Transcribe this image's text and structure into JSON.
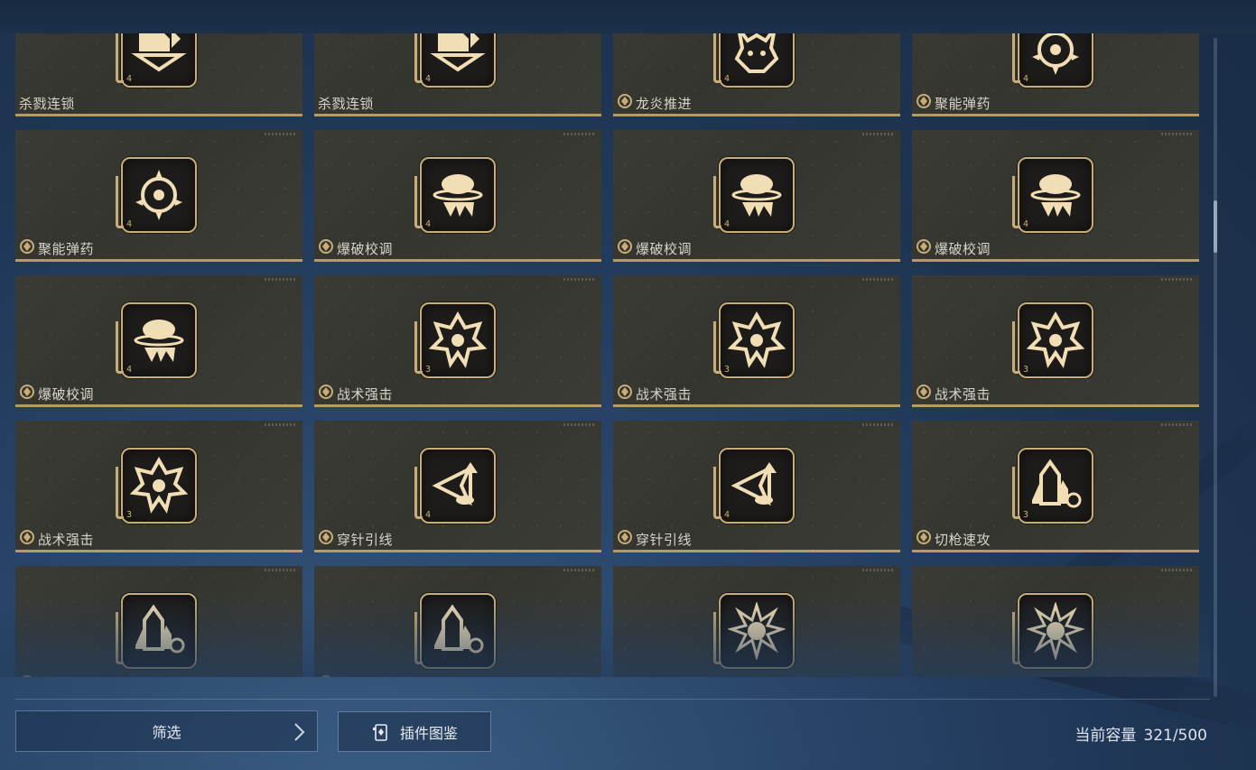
{
  "colors": {
    "card_bg": "#36362f",
    "gold_accent": "#b89b63",
    "icon_gold": "#f1deb5",
    "frame_gold": "#c9ad78",
    "background": "#22395a"
  },
  "modules": [
    {
      "label": "杀戮连锁",
      "icon": "kill-chain-icon",
      "tier": "4",
      "show_ring": false
    },
    {
      "label": "杀戮连锁",
      "icon": "kill-chain-icon",
      "tier": "4",
      "show_ring": false
    },
    {
      "label": "龙炎推进",
      "icon": "dragon-flame-icon",
      "tier": "4",
      "show_ring": true
    },
    {
      "label": "聚能弹药",
      "icon": "focus-ammo-icon",
      "tier": "4",
      "show_ring": true
    },
    {
      "label": "聚能弹药",
      "icon": "focus-ammo-icon",
      "tier": "4",
      "show_ring": true
    },
    {
      "label": "爆破校调",
      "icon": "blast-calibration-icon",
      "tier": "4",
      "show_ring": true
    },
    {
      "label": "爆破校调",
      "icon": "blast-calibration-icon",
      "tier": "4",
      "show_ring": true
    },
    {
      "label": "爆破校调",
      "icon": "blast-calibration-icon",
      "tier": "4",
      "show_ring": true
    },
    {
      "label": "爆破校调",
      "icon": "blast-calibration-icon",
      "tier": "4",
      "show_ring": true
    },
    {
      "label": "战术强击",
      "icon": "tactical-strike-icon",
      "tier": "3",
      "show_ring": true
    },
    {
      "label": "战术强击",
      "icon": "tactical-strike-icon",
      "tier": "3",
      "show_ring": true
    },
    {
      "label": "战术强击",
      "icon": "tactical-strike-icon",
      "tier": "3",
      "show_ring": true
    },
    {
      "label": "战术强击",
      "icon": "tactical-strike-icon",
      "tier": "3",
      "show_ring": true
    },
    {
      "label": "穿针引线",
      "icon": "threading-needle-icon",
      "tier": "4",
      "show_ring": true
    },
    {
      "label": "穿针引线",
      "icon": "threading-needle-icon",
      "tier": "4",
      "show_ring": true
    },
    {
      "label": "切枪速攻",
      "icon": "swap-assault-icon",
      "tier": "3",
      "show_ring": true
    },
    {
      "label": "",
      "icon": "swap-assault-icon",
      "tier": "",
      "show_ring": true
    },
    {
      "label": "",
      "icon": "swap-assault-icon",
      "tier": "",
      "show_ring": true
    },
    {
      "label": "",
      "icon": "burst-icon",
      "tier": "",
      "show_ring": false
    },
    {
      "label": "",
      "icon": "burst-icon",
      "tier": "",
      "show_ring": false
    }
  ],
  "footer": {
    "filter_label": "筛选",
    "codex_label": "插件图鉴",
    "capacity_label": "当前容量",
    "capacity_value": "321/500"
  }
}
